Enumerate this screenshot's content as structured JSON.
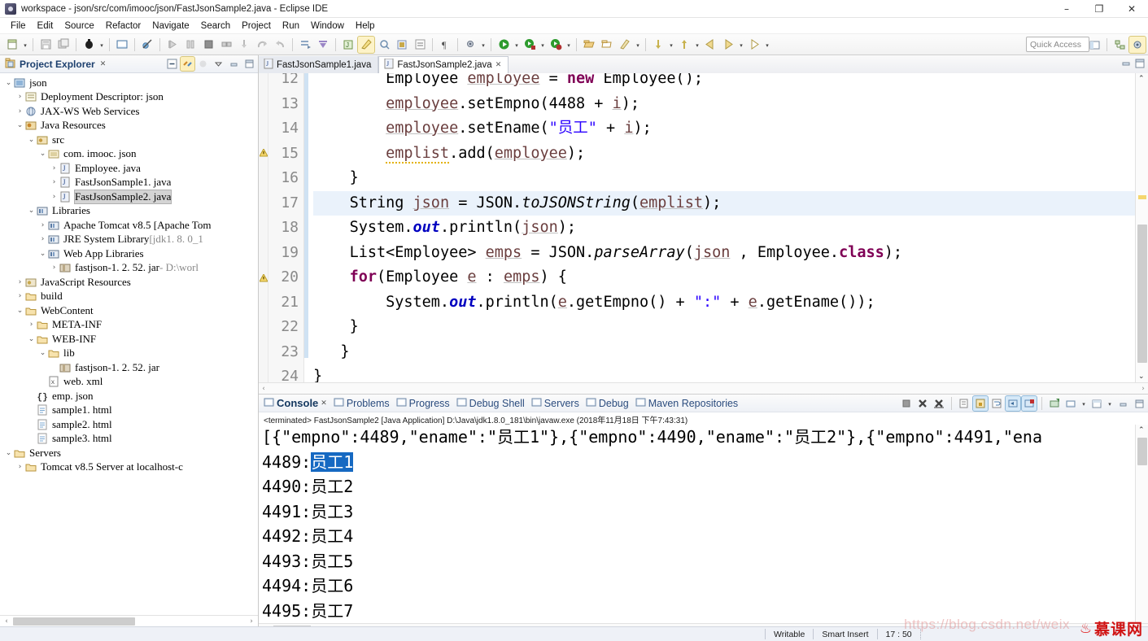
{
  "window": {
    "title": "workspace - json/src/com/imooc/json/FastJsonSample2.java - Eclipse IDE",
    "minimize": "–",
    "maximize": "❐",
    "close": "✕"
  },
  "menu": {
    "items": [
      "File",
      "Edit",
      "Source",
      "Refactor",
      "Navigate",
      "Search",
      "Project",
      "Run",
      "Window",
      "Help"
    ]
  },
  "toolbar": {
    "quick_access_placeholder": "Quick Access",
    "icons": [
      "new-wizard-icon",
      "new-dropdown-icon",
      "save-icon",
      "save-all-icon",
      "debug-icon",
      "debug-dropdown-icon",
      "open-console-icon",
      "skip-breakpoints-icon",
      "resume-icon",
      "suspend-icon",
      "terminate-icon",
      "disconnect-icon",
      "step-into-icon",
      "step-over-icon",
      "step-return-icon",
      "drop-to-frame-icon",
      "use-step-filters-icon",
      "new-java-project-icon",
      "new-java-class-icon",
      "new-annotation-icon",
      "new-package-icon",
      "instance-count-icon",
      "toggle-mark-occurrences-icon",
      "external-tools-icon",
      "external-tools-dropdown-icon",
      "run-icon",
      "run-dropdown-icon",
      "run-as-icon",
      "run-as-dropdown-icon",
      "coverage-icon",
      "coverage-dropdown-icon",
      "open-type-icon",
      "open-task-icon",
      "search-icon",
      "search-dropdown-icon",
      "previous-annotation-icon",
      "previous-dropdown-icon",
      "next-annotation-icon",
      "next-dropdown-icon",
      "back-icon",
      "forward-icon",
      "forward-dropdown-icon",
      "next-edit-icon",
      "next-edit-dropdown-icon"
    ],
    "perspective_icons": [
      "open-perspective-icon",
      "java-ee-perspective-icon",
      "debug-perspective-icon"
    ]
  },
  "explorer": {
    "title": "Project Explorer",
    "close_glyph": "✕",
    "tools": [
      "collapse-all-icon",
      "link-with-editor-icon",
      "focus-on-active-task-icon",
      "view-menu-icon",
      "minimize-icon",
      "maximize-icon"
    ],
    "tree": [
      {
        "label": "json",
        "indent": 0,
        "twist": "⌄",
        "icon": "project-icon",
        "selected": false
      },
      {
        "label": "Deployment Descriptor: json",
        "indent": 1,
        "twist": "›",
        "icon": "deployment-descriptor-icon",
        "selected": false
      },
      {
        "label": "JAX-WS Web Services",
        "indent": 1,
        "twist": "›",
        "icon": "web-services-icon",
        "selected": false
      },
      {
        "label": "Java Resources",
        "indent": 1,
        "twist": "⌄",
        "icon": "java-resources-icon",
        "selected": false
      },
      {
        "label": "src",
        "indent": 2,
        "twist": "⌄",
        "icon": "source-folder-icon",
        "selected": false
      },
      {
        "label": "com. imooc. json",
        "indent": 3,
        "twist": "⌄",
        "icon": "package-icon",
        "selected": false
      },
      {
        "label": "Employee. java",
        "indent": 4,
        "twist": "›",
        "icon": "java-file-icon",
        "selected": false
      },
      {
        "label": "FastJsonSample1. java",
        "indent": 4,
        "twist": "›",
        "icon": "java-file-icon",
        "selected": false
      },
      {
        "label": "FastJsonSample2. java",
        "indent": 4,
        "twist": "›",
        "icon": "java-file-icon",
        "selected": true
      },
      {
        "label": "Libraries",
        "indent": 2,
        "twist": "⌄",
        "icon": "libraries-icon",
        "selected": false
      },
      {
        "label": "Apache Tomcat v8.5 [Apache Tom",
        "indent": 3,
        "twist": "›",
        "icon": "library-icon",
        "selected": false
      },
      {
        "label": "JRE System Library",
        "label_dim": " [jdk1. 8. 0_1",
        "indent": 3,
        "twist": "›",
        "icon": "library-icon",
        "selected": false
      },
      {
        "label": "Web App Libraries",
        "indent": 3,
        "twist": "⌄",
        "icon": "library-icon",
        "selected": false
      },
      {
        "label": "fastjson-1. 2. 52. jar",
        "label_dim": " - D:\\worl",
        "indent": 4,
        "twist": "›",
        "icon": "jar-icon",
        "selected": false
      },
      {
        "label": "JavaScript Resources",
        "indent": 1,
        "twist": "›",
        "icon": "javascript-resources-icon",
        "selected": false
      },
      {
        "label": "build",
        "indent": 1,
        "twist": "›",
        "icon": "folder-icon",
        "selected": false
      },
      {
        "label": "WebContent",
        "indent": 1,
        "twist": "⌄",
        "icon": "folder-icon",
        "selected": false
      },
      {
        "label": "META-INF",
        "indent": 2,
        "twist": "›",
        "icon": "folder-icon",
        "selected": false
      },
      {
        "label": "WEB-INF",
        "indent": 2,
        "twist": "⌄",
        "icon": "folder-icon",
        "selected": false
      },
      {
        "label": "lib",
        "indent": 3,
        "twist": "⌄",
        "icon": "folder-icon",
        "selected": false
      },
      {
        "label": "fastjson-1. 2. 52. jar",
        "indent": 4,
        "twist": "",
        "icon": "jar-icon",
        "selected": false
      },
      {
        "label": "web. xml",
        "indent": 3,
        "twist": "",
        "icon": "xml-file-icon",
        "selected": false
      },
      {
        "label": "emp. json",
        "indent": 2,
        "twist": "",
        "icon": "json-file-icon",
        "selected": false
      },
      {
        "label": "sample1. html",
        "indent": 2,
        "twist": "",
        "icon": "html-file-icon",
        "selected": false
      },
      {
        "label": "sample2. html",
        "indent": 2,
        "twist": "",
        "icon": "html-file-icon",
        "selected": false
      },
      {
        "label": "sample3. html",
        "indent": 2,
        "twist": "",
        "icon": "html-file-icon",
        "selected": false
      },
      {
        "label": "Servers",
        "indent": 0,
        "twist": "⌄",
        "icon": "folder-icon",
        "selected": false
      },
      {
        "label": "Tomcat v8.5 Server at localhost-c",
        "indent": 1,
        "twist": "›",
        "icon": "folder-icon",
        "selected": false
      }
    ],
    "hscroll": {
      "left_arrow": "‹",
      "right_arrow": "›"
    }
  },
  "editor": {
    "tabs": [
      {
        "label": "FastJsonSample1.java",
        "active": false,
        "icon": "java-file-icon"
      },
      {
        "label": "FastJsonSample2.java",
        "active": true,
        "icon": "java-file-icon",
        "close_glyph": "✕"
      }
    ],
    "tools": [
      "minimize-icon",
      "maximize-icon"
    ],
    "first_visible_line": 12,
    "highlighted_line": 17,
    "lines": [
      {
        "no": "12",
        "indent": 2,
        "clipped_top": true,
        "tokens": [
          {
            "t": "Employee ",
            "c": "plain"
          },
          {
            "t": "employee",
            "c": "lvar"
          },
          {
            "t": " = ",
            "c": "plain"
          },
          {
            "t": "new",
            "c": "kw"
          },
          {
            "t": " Employee();",
            "c": "plain"
          }
        ]
      },
      {
        "no": "13",
        "indent": 2,
        "tokens": [
          {
            "t": "employee",
            "c": "lvar"
          },
          {
            "t": ".setEmpno(4488 + ",
            "c": "plain"
          },
          {
            "t": "i",
            "c": "lvar"
          },
          {
            "t": ");",
            "c": "plain"
          }
        ]
      },
      {
        "no": "14",
        "indent": 2,
        "tokens": [
          {
            "t": "employee",
            "c": "lvar"
          },
          {
            "t": ".setEname(",
            "c": "plain"
          },
          {
            "t": "\"员工\"",
            "c": "str"
          },
          {
            "t": " + ",
            "c": "plain"
          },
          {
            "t": "i",
            "c": "lvar"
          },
          {
            "t": ");",
            "c": "plain"
          }
        ]
      },
      {
        "no": "15",
        "indent": 2,
        "marker": "warning",
        "tokens": [
          {
            "t": "emplist",
            "c": "lvar-warn"
          },
          {
            "t": ".add(",
            "c": "plain"
          },
          {
            "t": "employee",
            "c": "lvar"
          },
          {
            "t": ");",
            "c": "plain"
          }
        ]
      },
      {
        "no": "16",
        "indent": 1,
        "tokens": [
          {
            "t": "}",
            "c": "plain"
          }
        ]
      },
      {
        "no": "17",
        "indent": 1,
        "highlight": true,
        "tokens": [
          {
            "t": "String ",
            "c": "plain"
          },
          {
            "t": "json",
            "c": "lvar"
          },
          {
            "t": " = JSON.",
            "c": "plain"
          },
          {
            "t": "toJSONString",
            "c": "stm"
          },
          {
            "t": "(",
            "c": "plain"
          },
          {
            "t": "emplist",
            "c": "lvar"
          },
          {
            "t": ");",
            "c": "plain"
          }
        ]
      },
      {
        "no": "18",
        "indent": 1,
        "tokens": [
          {
            "t": "System.",
            "c": "plain"
          },
          {
            "t": "out",
            "c": "fld"
          },
          {
            "t": ".println(",
            "c": "plain"
          },
          {
            "t": "json",
            "c": "lvar"
          },
          {
            "t": ");",
            "c": "plain"
          }
        ]
      },
      {
        "no": "19",
        "indent": 1,
        "tokens": [
          {
            "t": "List<Employee> ",
            "c": "plain"
          },
          {
            "t": "emps",
            "c": "lvar"
          },
          {
            "t": " = JSON.",
            "c": "plain"
          },
          {
            "t": "parseArray",
            "c": "stm"
          },
          {
            "t": "(",
            "c": "plain"
          },
          {
            "t": "json",
            "c": "lvar"
          },
          {
            "t": " , Employee.",
            "c": "plain"
          },
          {
            "t": "class",
            "c": "kw"
          },
          {
            "t": ");",
            "c": "plain"
          }
        ]
      },
      {
        "no": "20",
        "indent": 1,
        "marker": "warning",
        "tokens": [
          {
            "t": "for",
            "c": "kw"
          },
          {
            "t": "(Employee ",
            "c": "plain"
          },
          {
            "t": "e",
            "c": "lvar"
          },
          {
            "t": " : ",
            "c": "plain"
          },
          {
            "t": "emps",
            "c": "lvar"
          },
          {
            "t": ") {",
            "c": "plain"
          }
        ]
      },
      {
        "no": "21",
        "indent": 2,
        "tokens": [
          {
            "t": "System.",
            "c": "plain"
          },
          {
            "t": "out",
            "c": "fld"
          },
          {
            "t": ".println(",
            "c": "plain"
          },
          {
            "t": "e",
            "c": "lvar"
          },
          {
            "t": ".getEmpno() + ",
            "c": "plain"
          },
          {
            "t": "\":\"",
            "c": "str"
          },
          {
            "t": " + ",
            "c": "plain"
          },
          {
            "t": "e",
            "c": "lvar"
          },
          {
            "t": ".getEname());",
            "c": "plain"
          }
        ]
      },
      {
        "no": "22",
        "indent": 1,
        "tokens": [
          {
            "t": "}",
            "c": "plain"
          }
        ]
      },
      {
        "no": "23",
        "indent": 0.7,
        "tokens": [
          {
            "t": "}",
            "c": "plain"
          }
        ]
      },
      {
        "no": "24",
        "indent": 0,
        "tokens": [
          {
            "t": "}",
            "c": "plain"
          }
        ]
      }
    ],
    "hscroll": {
      "left_arrow": "‹",
      "right_arrow": "›"
    }
  },
  "console": {
    "tabs": [
      {
        "label": "Console",
        "active": true,
        "icon": "console-icon",
        "close_glyph": "✕"
      },
      {
        "label": "Problems",
        "active": false,
        "icon": "problems-icon"
      },
      {
        "label": "Progress",
        "active": false,
        "icon": "progress-icon"
      },
      {
        "label": "Debug Shell",
        "active": false,
        "icon": "debug-shell-icon"
      },
      {
        "label": "Servers",
        "active": false,
        "icon": "servers-icon"
      },
      {
        "label": "Debug",
        "active": false,
        "icon": "debug-icon"
      },
      {
        "label": "Maven Repositories",
        "active": false,
        "icon": "maven-repositories-icon"
      }
    ],
    "tools": [
      "terminate-icon",
      "remove-launch-icon",
      "remove-all-terminated-icon",
      "clear-console-icon",
      "scroll-lock-icon",
      "word-wrap-icon",
      "show-console-on-output-icon",
      "pin-console-icon",
      "display-selected-console-icon",
      "open-console-icon",
      "open-console-dropdown-icon",
      "new-console-view-icon",
      "new-console-dropdown-icon",
      "minimize-icon",
      "maximize-icon"
    ],
    "process_line": "<terminated> FastJsonSample2 [Java Application] D:\\Java\\jdk1.8.0_181\\bin\\javaw.exe (2018年11月18日 下午7:43:31)",
    "output_lines": [
      {
        "text": "[{\"empno\":4489,\"ename\":\"员工1\"},{\"empno\":4490,\"ename\":\"员工2\"},{\"empno\":4491,\"ena",
        "selection": null
      },
      {
        "text": "4489:",
        "selection": "员工1"
      },
      {
        "text": "4490:员工2",
        "selection": null
      },
      {
        "text": "4491:员工3",
        "selection": null
      },
      {
        "text": "4492:员工4",
        "selection": null
      },
      {
        "text": "4493:员工5",
        "selection": null
      },
      {
        "text": "4494:员工6",
        "selection": null
      },
      {
        "text": "4495:员工7",
        "selection": null
      }
    ],
    "hscroll": {
      "left_arrow": "‹",
      "right_arrow": "›"
    }
  },
  "statusbar": {
    "writable": "Writable",
    "insert_mode": "Smart Insert",
    "cursor_position": "17 : 50",
    "watermark": "https://blog.csdn.net/weix",
    "logo_text": "慕课网",
    "logo_flame": "♨"
  },
  "colors": {
    "selection_blue": "#1669c2",
    "keyword_purple": "#7f0055",
    "string_blue": "#2a00ff",
    "field_blue": "#0000c0",
    "highlight_line": "#eaf2fb",
    "tree_selection": "#d4d4d4"
  }
}
